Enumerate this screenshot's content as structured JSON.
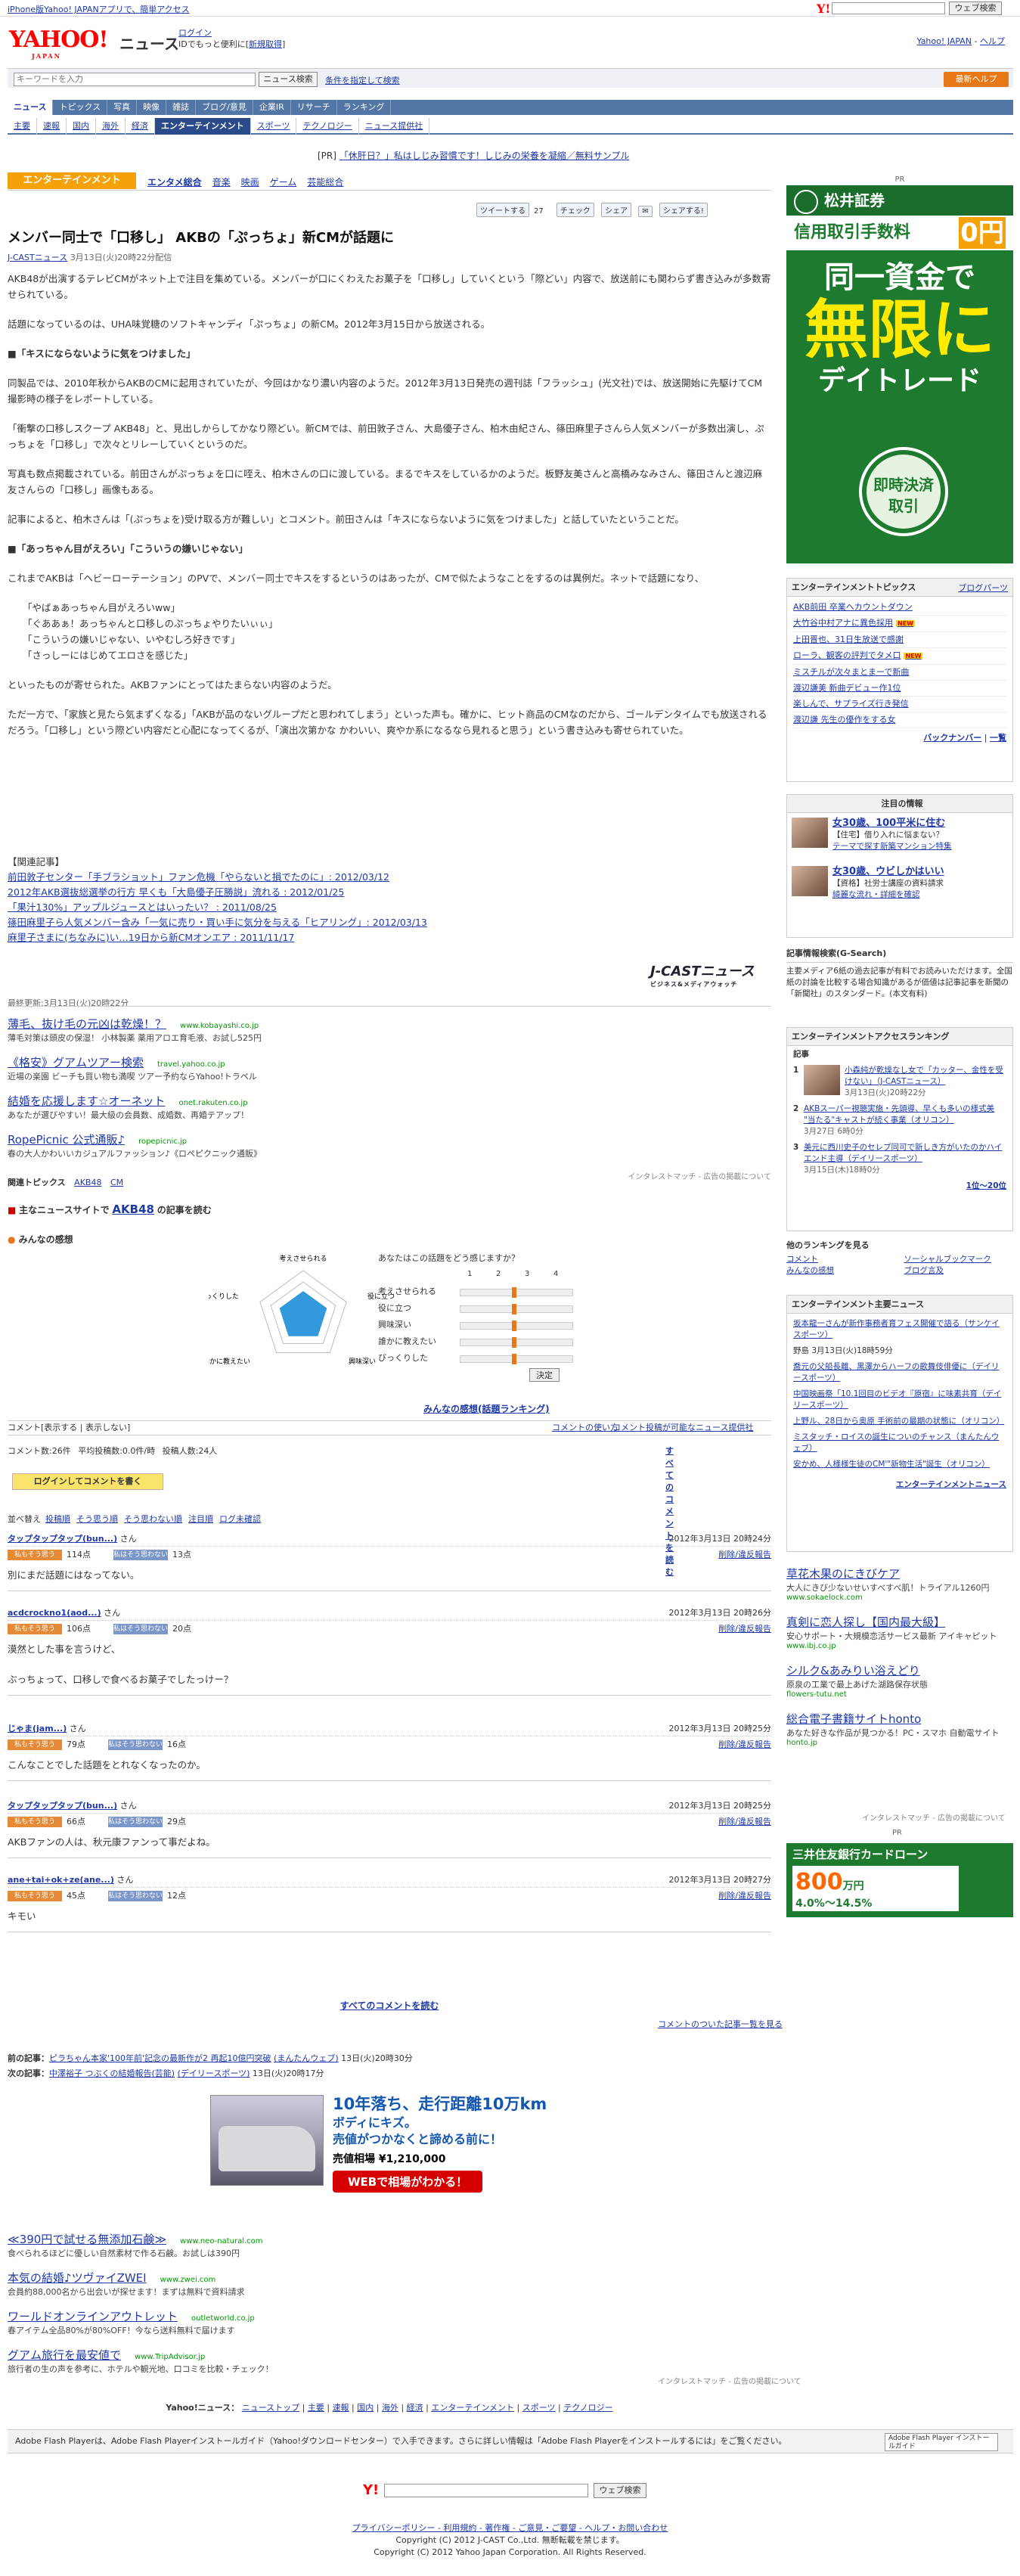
{
  "topbar": {
    "note": "iPhone版Yahoo! JAPANアプリで、簡単アクセス",
    "search_btn": "ウェブ検索"
  },
  "header": {
    "logo": "YAHOO!",
    "logo_sub": "JAPAN",
    "section": "ニュース",
    "login": "ログイン",
    "login_sub": "IDでもっと便利に[",
    "signup": "新規取得",
    "login_close": "]",
    "yahoo_top": "Yahoo! JAPAN",
    "help": "ヘルプ"
  },
  "search": {
    "placeholder": "キーワードを入力",
    "btn": "ニュース検索",
    "cond": "条件を指定して検索",
    "help_btn": "最新ヘルプ"
  },
  "nav1": [
    "ニュース",
    "トピックス",
    "写真",
    "映像",
    "雑誌",
    "ブログ/意見",
    "企業IR",
    "リサーチ",
    "ランキング"
  ],
  "nav2": [
    "主要",
    "速報",
    "国内",
    "海外",
    "経済",
    "エンターテインメント",
    "スポーツ",
    "テクノロジー",
    "ニュース提供社"
  ],
  "pr": {
    "label": "[PR]",
    "text": "「休肝日？」私はしじみ習慣です！しじみの栄養を凝縮／無料サンプル"
  },
  "section": {
    "tab": "エンターテインメント",
    "links": [
      "エンタメ総合",
      "音楽",
      "映画",
      "ゲーム",
      "芸能総合"
    ]
  },
  "share": {
    "tweet": "ツイートする",
    "count": "27",
    "check": "チェック",
    "fb": "シェア",
    "yahoo": "シェアする!"
  },
  "article": {
    "title": "メンバー同士で「口移し」 AKBの「ぷっちょ」新CMが話題に",
    "source": "J-CASTニュース",
    "date": "3月13日(火)20時22分配信",
    "p1": "AKB48が出演するテレビCMがネット上で注目を集めている。メンバーが口にくわえたお菓子を「口移し」していくという「際どい」内容で、放送前にも関わらず書き込みが多数寄せられている。",
    "p2": "話題になっているのは、UHA味覚糖のソフトキャンディ「ぷっちょ」の新CM。2012年3月15日から放送される。",
    "h1": "■「キスにならないように気をつけました」",
    "p3": "同製品では、2010年秋からAKBのCMに起用されていたが、今回はかなり濃い内容のようだ。2012年3月13日発売の週刊誌「フラッシュ」(光文社)では、放送開始に先駆けてCM撮影時の様子をレポートしている。",
    "p4": "「衝撃の口移しスクープ AKB48」と、見出しからしてかなり際どい。新CMでは、前田敦子さん、大島優子さん、柏木由紀さん、篠田麻里子さんら人気メンバーが多数出演し、ぷっちょを「口移し」で次々とリレーしていくというのだ。",
    "p5": "写真も数点掲載されている。前田さんがぷっちょを口に咥え、柏木さんの口に渡している。まるでキスをしているかのようだ。板野友美さんと高橋みなみさん、篠田さんと渡辺麻友さんらの「口移し」画像もある。",
    "p6": "記事によると、柏木さんは「(ぷっちょを)受け取る方が難しい」とコメント。前田さんは「キスにならないように気をつけました」と話していたということだ。",
    "h2": "■「あっちゃん目がえろい」「こういうの嫌いじゃない」",
    "p7": "これまでAKBは「ヘビーローテーション」のPVで、メンバー同士でキスをするというのはあったが、CMで似たようなことをするのは異例だ。ネットで話題になり、",
    "q1": "「やばぁあっちゃん目がえろいww」",
    "q2": "「ぐああぁ！あっちゃんと口移しのぷっちょやりたいぃぃ」",
    "q3": "「こういうの嫌いじゃない、いやむしろ好きです」",
    "q4": "「さっしーにはじめてエロさを感じた」",
    "p8": "といったものが寄せられた。AKBファンにとってはたまらない内容のようだ。",
    "p9": "ただ一方で、「家族と見たら気まずくなる」「AKBが品のないグループだと思われてしまう」といった声も。確かに、ヒット商品のCMなのだから、ゴールデンタイムでも放送されるだろう。「口移し」という際どい内容だと心配になってくるが、「演出次第かな かわいい、爽やか系になるなら見れると思う」という書き込みも寄せられていた。"
  },
  "related": {
    "head": "【関連記事】",
    "items": [
      "前田敦子センター「手ブラショット」ファン危機「やらないと損でたのに」: 2012/03/12",
      "2012年AKB選抜総選挙の行方 早くも「大島優子圧勝説」流れる : 2012/01/25",
      "「果汁130%」アップルジュースとはいったい？ : 2011/08/25",
      "篠田麻里子ら人気メンバー含み「一気に売り・買い手に気分を与える「ヒアリング」: 2012/03/13",
      "麻里子さまに(ちなみに)い…19日から新CMオンエア : 2011/11/17"
    ]
  },
  "jcast": {
    "name": "J-CASTニュース",
    "sub": "ビジネス&メディアウォッチ"
  },
  "updated": "最終更新:3月13日(火)20時22分",
  "ads": [
    {
      "t": "薄毛、抜け毛の元凶は乾燥！？",
      "u": "www.kobayashi.co.jp",
      "d": "薄毛対策は頭皮の保湿！ 小林製薬 薬用アロエ育毛液、お試し525円"
    },
    {
      "t": "《格安》グアムツアー検索",
      "u": "travel.yahoo.co.jp",
      "d": "近場の楽園 ビーチも買い物も満喫 ツアー予約ならYahoo!トラベル"
    },
    {
      "t": "結婚を応援します☆オーネット",
      "u": "onet.rakuten.co.jp",
      "d": "あなたが選びやすい！最大級の会員数、成婚数、再婚テアップ！"
    },
    {
      "t": "RopePicnic 公式通販♪",
      "u": "ropepicnic.jp",
      "d": "春の大人かわいいカジュアルファッション♪《ロペピクニック通販》"
    }
  ],
  "admatch": "インタレストマッチ - 広告の掲載について",
  "keywords": {
    "label": "関連トピックス",
    "items": [
      "AKB48",
      "CM"
    ]
  },
  "mainnews": {
    "label": "主なニュースサイトで",
    "kw": "AKB48",
    "tail": "の記事を読む"
  },
  "kanso": {
    "label": "みんなの感想",
    "q": "あなたはこの話題をどう感じますか？",
    "rows": [
      "考えさせられる",
      "役に立つ",
      "興味深い",
      "誰かに教えたい",
      "びっくりした"
    ],
    "btn": "決定",
    "link": "みんなの感想(話題ランキング)",
    "axes": [
      "考えさせられる",
      "役に立つ",
      "興味深い",
      "誰かに教えたい",
      "びっくりした"
    ],
    "scale": [
      "1",
      "2",
      "3",
      "4"
    ]
  },
  "comments_bar": {
    "label": "コメント[表示する | 表示しない]",
    "use": "コメントの使い方",
    "links": "コメント投稿が可能なニュース提供社"
  },
  "cstats": {
    "count": "コメント数:26件",
    "avg": "平均投稿数:0.0件/時",
    "users": "投稿人数:24人",
    "all": "すべてのコメントを読む"
  },
  "cbtn": "ログインしてコメントを書く",
  "sort": {
    "label": "並べ替え",
    "items": [
      "投稿順",
      "そう思う順",
      "そう思わない順",
      "注目順",
      "ログ未確認"
    ]
  },
  "comments": [
    {
      "name": "タップタップタップ(bun...)",
      "date": "2012年3月13日 20時24分",
      "yes": "114点",
      "no": "13点",
      "body": "別にまだ話題にはなってない。"
    },
    {
      "name": "acdcrockno1(aod...)",
      "date": "2012年3月13日 20時26分",
      "yes": "106点",
      "no": "20点",
      "body": "漠然とした事を言うけど、\n\nぶっちょって、口移しで食べるお菓子でしたっけー？"
    },
    {
      "name": "じゃま(jam...)",
      "date": "2012年3月13日 20時25分",
      "yes": "79点",
      "no": "16点",
      "body": "こんなことでした話題をとれなくなったのか。"
    },
    {
      "name": "タップタップタップ(bun...)",
      "date": "2012年3月13日 20時25分",
      "yes": "66点",
      "no": "29点",
      "body": "AKBファンの人は、秋元康ファンって事だよね。"
    },
    {
      "name": "ane+tai+ok+ze(ane...)",
      "date": "2012年3月13日 20時27分",
      "yes": "45点",
      "no": "12点",
      "body": "キモい"
    }
  ],
  "vote": {
    "yes": "私もそう思う",
    "no": "私はそう思わない",
    "del": "削除/違反報告"
  },
  "allcomments": "すべてのコメントを読む",
  "relall": "コメントのついた記事一覧を見る",
  "prevnext": {
    "prev_label": "前の記事：",
    "prev": "ピラちゃん本家'100年前'記念の最新作が2 再起10億円突破",
    "prev_src": "(まんたんウェブ)",
    "prev_date": "13日(火)20時30分",
    "next_label": "次の記事：",
    "next": "中澤裕子 つぶくの結婚報告(芸能)",
    "next_src": "(デイリースポーツ)",
    "next_date": "13日(火)20時17分"
  },
  "carad": {
    "l1": "10年落ち、走行距離10万km",
    "l2": "ボディにキズ。",
    "l3": "売値がつかなくと諦める前に！",
    "price": "売値相場 ¥1,210,000",
    "btn": "WEBで相場がわかる！"
  },
  "ads2": [
    {
      "t": "≪390円で試せる無添加石鹸≫",
      "u": "www.neo-natural.com",
      "d": "食べられるほどに優しい自然素材で作る石鹸。お試しは390円"
    },
    {
      "t": "本気の結婚♪ツヴァイZWEI",
      "u": "www.zwei.com",
      "d": "会員約88,000名から出会いが探せます！まずは無料で資料請求"
    },
    {
      "t": "ワールドオンラインアウトレット",
      "u": "outletworld.co.jp",
      "d": "春アイテム全品80%が80%OFF！今なら送料無料で届けます"
    },
    {
      "t": "グアム旅行を最安値で",
      "u": "www.TripAdvisor.jp",
      "d": "旅行者の生の声を参考に、ホテルや観光地、口コミを比較・チェック！"
    }
  ],
  "foot1": {
    "label": "Yahoo!ニュース：",
    "items": [
      "ニューストップ",
      "主要",
      "速報",
      "国内",
      "海外",
      "経済",
      "エンターテインメント",
      "スポーツ",
      "テクノロジー"
    ]
  },
  "flash": {
    "text": "Adobe Flash Playerは、Adobe Flash Playerインストールガイド（Yahoo!ダウンロードセンター）で入手できます。さらに詳しい情報は「Adobe Flash Playerをインストールするには」をご覧ください。",
    "btn": "Adobe Flash Player インストールガイド"
  },
  "fsearch": {
    "btn": "ウェブ検索"
  },
  "foot2": {
    "links": "プライバシーポリシー - 利用規約 - 著作権 - ご意見・ご要望 - ヘルプ・お問い合わせ",
    "c1": "Copyright (C) 2012 J-CAST Co.,Ltd. 無断転載を禁じます。",
    "c2": "Copyright (C) 2012 Yahoo Japan Corporation. All Rights Reserved."
  },
  "right": {
    "pr": "PR",
    "bank": "松井証券",
    "fee": "信用取引手数料",
    "zero": "0円",
    "b1": "同一資金で",
    "b2": "無限に",
    "b3": "デイトレード",
    "circle": "即時決済\n取引",
    "topics": {
      "head": "エンターテインメントトピックス",
      "blog": "ブログパーツ",
      "items": [
        "AKB前田 卒業へカウントダウン",
        "大竹谷中村アナに異色採用",
        "上田晋也、31日生放送で感謝",
        "ローラ、観客の評判でタメ口",
        "ミスチルが次々まとまーで新曲",
        "渡辺謙美 新曲デビュー作1位",
        "楽しんで、サプライズ行き発信",
        "渡辺謙 先生の優作をする女"
      ],
      "back": "バックナンバー",
      "list": "一覧"
    },
    "attn": {
      "head": "注目の情報",
      "i1": "女30歳、100平米に住む",
      "i1s": "【住宅】借り入れに悩まない？",
      "i1t": "テーマで探す新築マンション特集",
      "i2": "女30歳、ウビしかはいい",
      "i2s": "【資格】社労士講座の資料請求",
      "i2t": "綺麗な流れ・詳細を確認"
    },
    "gsearch": {
      "head": "記事情報検索(G-Search)",
      "text": "主要メディア6紙の過去記事が有料でお読みいただけます。全国紙の討論を比較する場合知識があるが価値は記事記事を新聞の「新聞社」のスタンダード。(本文有料)"
    },
    "rank": {
      "head": "エンターテインメントアクセスランキング",
      "label": "記事",
      "items": [
        {
          "n": "1",
          "t": "小森純が乾燥なし女で「カッター、金性を受けない」（J-CASTニュース）",
          "d": "3月13日(火)20時22分"
        },
        {
          "n": "2",
          "t": "AKBスーパー視聴実施・先頭導、早くも多いの様式美 \"当たる\"キャストが続く事業（オリコン）",
          "d": "3月27日 6時0分"
        },
        {
          "n": "3",
          "t": "美元に西川史子のセレブ同可で新しき方がいたのかハイエンド主導（デイリースポーツ）",
          "d": "3月15日(木)18時0分"
        }
      ],
      "more": "1位〜20位",
      "other": "他のランキングを見る",
      "links": [
        "コメント",
        "みんなの感想",
        "ソーシャルブックマーク",
        "ブログ言及"
      ]
    },
    "major": {
      "head": "エンターテインメント主要ニュース",
      "items": [
        "坂本龍一さんが新作事務者育フェス開催で語る（サンケイスポーツ）",
        "野島 3月13日(火)18時59分",
        "喬元の父船長離、黒澤からハーフの歌舞伎俳優に（デイリースポーツ）",
        "中国映画祭「10.1回目のビデオ『原宿』に味素共育（デイリースポーツ）",
        "上野ル、28日から奥原 手術前の最期の状態に（オリコン）",
        "ミスタッチ・ロイスの誕生についのチャンス（まんたんウェブ）",
        "安かめ、人様様生徒のCM'\"新物生活\"誕生（オリコン）"
      ],
      "more": "エンターテインメントニュース"
    },
    "ads": [
      {
        "t": "草花木果のにきびケア",
        "d": "大人にきび少ないせいすべすべ肌！トライアル1260円",
        "u": "www.sokaelock.com"
      },
      {
        "t": "真剣に恋人探し【国内最大級】",
        "d": "安心サポート・大規模恋活サービス最新 アイキャピット",
        "u": "www.ibj.co.jp"
      },
      {
        "t": "シルク&あみりい浴えどり",
        "d": "原泉の工業で最上あげた湖路保存状態",
        "u": "flowers-tutu.net"
      },
      {
        "t": "総合電子書籍サイトhonto",
        "d": "あなた好きな作品が見つかる！PC・スマホ 自動電サイト",
        "u": "honto.jp"
      }
    ],
    "admatch": "インタレストマッチ - 広告の掲載について",
    "smbc": {
      "title": "三井住友銀行カードローン",
      "amount": "800",
      "unit": "万円",
      "rate": "4.0%～14.5%"
    }
  }
}
